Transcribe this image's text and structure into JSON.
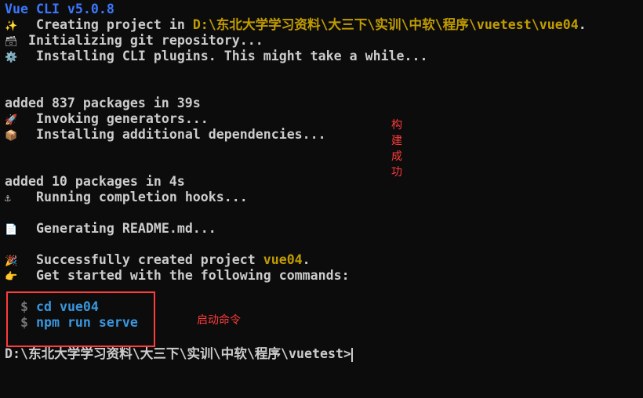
{
  "colors": {
    "background": "#0c0c0c",
    "text": "#cccccc",
    "title": "#3b78ff",
    "path": "#c19c00",
    "command": "#3a96dd",
    "annotation": "#ff3b3b"
  },
  "lines": {
    "title": "Vue CLI v5.0.8",
    "creating": "Creating project in ",
    "creating_path": "D:\\东北大学学习资料\\大三下\\实训\\中软\\程序\\vuetest\\vue04",
    "creating_end": ".",
    "git": "Initializing git repository...",
    "plugins": "Installing CLI plugins. This might take a while...",
    "added1": "added 837 packages in 39s",
    "invoking": "Invoking generators...",
    "deps": "Installing additional dependencies...",
    "added2": "added 10 packages in 4s",
    "hooks": "Running completion hooks...",
    "readme": "Generating README.md...",
    "success": "Successfully created project ",
    "success_name": "vue04",
    "success_end": ".",
    "getstarted": "Get started with the following commands:",
    "dollar": "$",
    "cmd1": "cd vue04",
    "cmd2": "npm run serve",
    "prompt": "D:\\东北大学学习资料\\大三下\\实训\\中软\\程序\\vuetest>"
  },
  "icons": {
    "sparkles": "✨",
    "git": "🗃",
    "gear": "⚙️",
    "rocket": "🚀",
    "package": "📦",
    "anchor": "⚓",
    "document": "📄",
    "party": "🎉",
    "point": "👉"
  },
  "annotations": {
    "build_success": "构建成功",
    "start_command": "启动命令"
  }
}
